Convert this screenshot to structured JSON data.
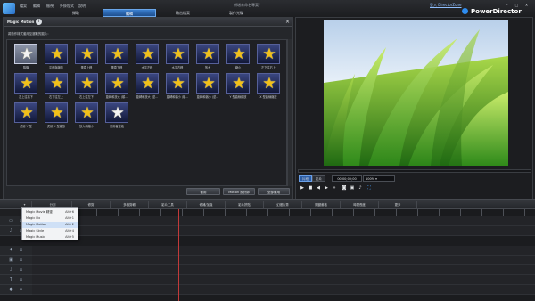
{
  "app": {
    "window_title": "新增未命名專案*",
    "brand": "PowerDirector",
    "login_link": "登入 DirectorZone",
    "menu": [
      "檔案",
      "編輯",
      "檢視",
      "外掛程式",
      "說明"
    ]
  },
  "main_tabs": [
    {
      "label": "擷取"
    },
    {
      "label": "編輯"
    },
    {
      "label": "輸出檔案"
    },
    {
      "label": "製作光碟"
    }
  ],
  "panel": {
    "title": "Magic Motion",
    "instruction": "將動作樣式套用至選取的圖片：",
    "items": [
      {
        "label": "隨機",
        "style": "selected"
      },
      {
        "label": "平移與縮放",
        "style": "gold"
      },
      {
        "label": "垂直上移",
        "style": "gold"
      },
      {
        "label": "垂直下移",
        "style": "gold"
      },
      {
        "label": "水平左移",
        "style": "gold"
      },
      {
        "label": "水平右移",
        "style": "gold"
      },
      {
        "label": "放大",
        "style": "gold"
      },
      {
        "label": "縮小",
        "style": "gold"
      },
      {
        "label": "左下往右上",
        "style": "gold"
      },
      {
        "label": "左上往右下",
        "style": "gold"
      },
      {
        "label": "右下往左上",
        "style": "gold"
      },
      {
        "label": "右上往左下",
        "style": "gold"
      },
      {
        "label": "旋轉和放大 (順...",
        "style": "gold"
      },
      {
        "label": "旋轉和放大 (逆...",
        "style": "gold"
      },
      {
        "label": "旋轉和縮小 (順...",
        "style": "gold"
      },
      {
        "label": "旋轉和縮小 (逆...",
        "style": "gold"
      },
      {
        "label": "Y 型曲線縮放",
        "style": "gold"
      },
      {
        "label": "X 型曲線縮放",
        "style": "gold"
      },
      {
        "label": "虎鯨 Y 型",
        "style": "gold"
      },
      {
        "label": "虎鯨 X 型縮放",
        "style": "gold"
      },
      {
        "label": "放大和縮小",
        "style": "gold"
      },
      {
        "label": "使用者定義",
        "style": "white"
      }
    ],
    "buttons": {
      "apply": "套用",
      "designer": "Motion 設計師",
      "apply_all": "全部套用"
    }
  },
  "preview": {
    "mode_clip": "片段",
    "mode_movie": "影片",
    "timecode": "00;00;00;00",
    "zoom": "100%",
    "controls": [
      "play-icon",
      "stop-icon",
      "prev-frame-icon",
      "next-frame-icon",
      "fast-forward-icon",
      "snapshot-icon",
      "pip-icon",
      "volume-icon",
      "fullscreen-icon"
    ]
  },
  "toolbar": {
    "items": [
      "分割",
      "修剪",
      "多機剪輯",
      "影片工具",
      "修補/加強",
      "影片拼貼",
      "幻燈片秀",
      "關鍵畫格",
      "時間長度",
      "更多"
    ]
  },
  "dropdown": {
    "items": [
      {
        "label": "Magic Movie 精靈",
        "key": "Alt+6",
        "selected": false
      },
      {
        "label": "Magic Fix",
        "key": "Alt+1",
        "selected": false
      },
      {
        "label": "Magic Motion",
        "key": "Alt+2",
        "selected": true
      },
      {
        "label": "Magic Style",
        "key": "Alt+4",
        "selected": false
      },
      {
        "label": "Magic Music",
        "key": "Alt+5",
        "selected": false
      }
    ]
  },
  "colors": {
    "accent_blue": "#2c5da4",
    "star_gold": "#f2c018",
    "thumb_navy": "#1c2554",
    "panel_bg": "#25272b",
    "playhead": "#c23a3a"
  }
}
